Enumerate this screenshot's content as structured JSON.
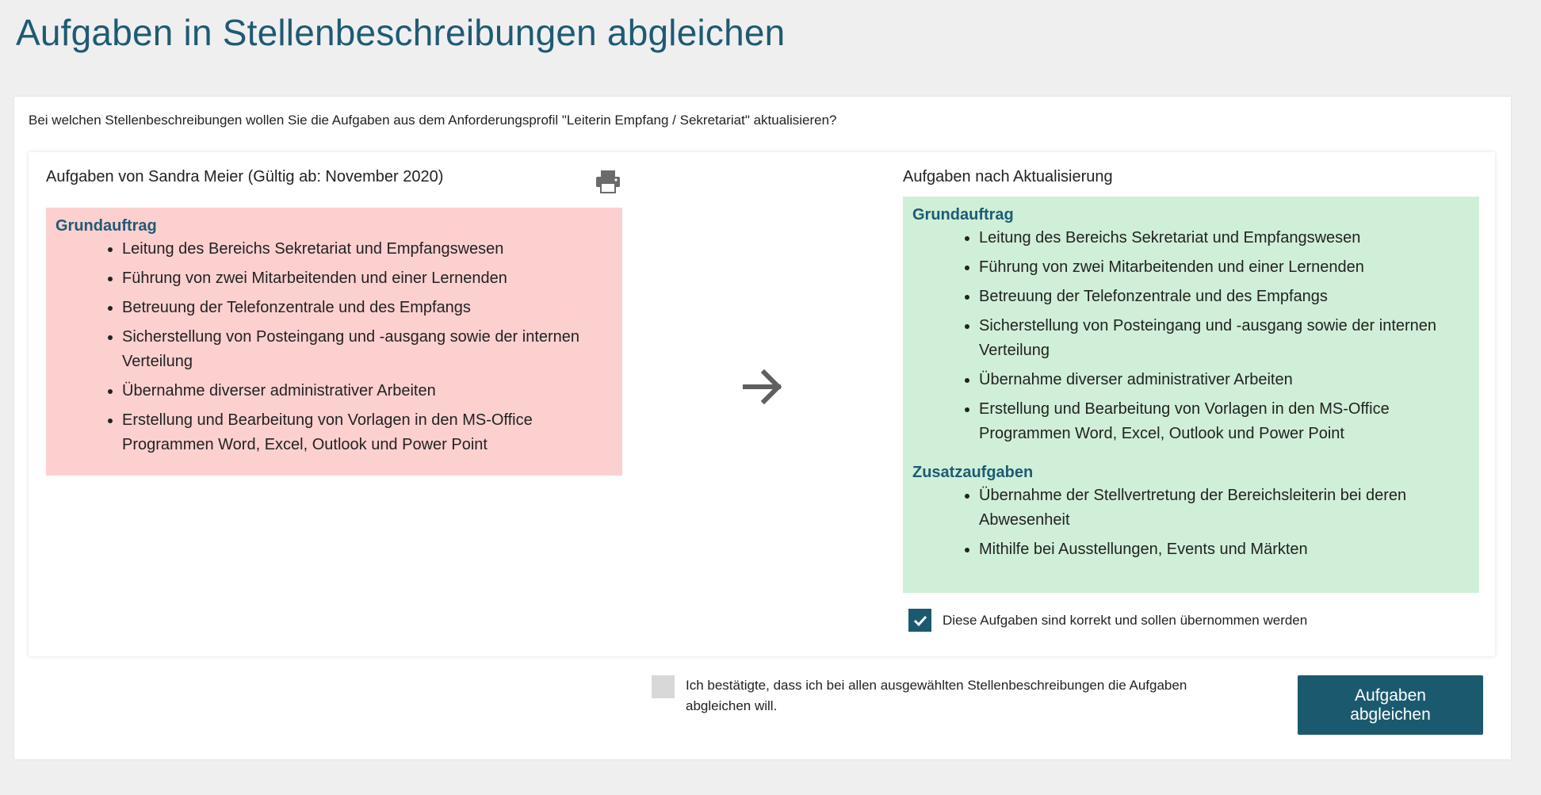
{
  "page": {
    "title": "Aufgaben in Stellenbeschreibungen abgleichen",
    "question": "Bei welchen Stellenbeschreibungen wollen Sie die Aufgaben aus dem Anforderungsprofil \"Leiterin Empfang / Sekretariat\" aktualisieren?"
  },
  "left": {
    "heading": "Aufgaben von Sandra Meier (Gültig ab: November 2020)",
    "print_icon": "print-icon",
    "color": "#fdd0d0",
    "sections": [
      {
        "title": "Grundauftrag",
        "items": [
          "Leitung des Bereichs Sekretariat und Empfangswesen",
          "Führung von zwei Mitarbeitenden und einer Lernenden",
          "Betreuung der Telefonzentrale und des Empfangs",
          "Sicherstellung von Posteingang und -ausgang sowie der internen Verteilung",
          "Übernahme diverser administrativer Arbeiten",
          "Erstellung und Bearbeitung von Vorlagen in den MS-Office Programmen Word, Excel, Outlook und Power Point"
        ]
      }
    ]
  },
  "arrow_icon": "arrow-right-icon",
  "right": {
    "heading": "Aufgaben nach Aktualisierung",
    "color": "#d0efd8",
    "sections": [
      {
        "title": "Grundauftrag",
        "items": [
          "Leitung des Bereichs Sekretariat und Empfangswesen",
          "Führung von zwei Mitarbeitenden und einer Lernenden",
          "Betreuung der Telefonzentrale und des Empfangs",
          "Sicherstellung von Posteingang und -ausgang sowie der internen Verteilung",
          "Übernahme diverser administrativer Arbeiten",
          "Erstellung und Bearbeitung von Vorlagen in den MS-Office Programmen Word, Excel, Outlook und Power Point"
        ]
      },
      {
        "title": "Zusatzaufgaben",
        "items": [
          "Übernahme der Stellvertretung der Bereichsleiterin bei deren Abwesenheit",
          "Mithilfe bei Ausstellungen, Events und Märkten"
        ]
      }
    ],
    "accept_label": "Diese Aufgaben sind korrekt und sollen übernommen werden",
    "accept_checked": true
  },
  "footer": {
    "confirm_label": "Ich bestätigte, dass ich bei allen ausgewählten Stellenbeschreibungen die Aufgaben abgleichen will.",
    "confirm_checked": false,
    "button_label": "Aufgaben abgleichen"
  },
  "colors": {
    "primary": "#1b5a6e",
    "title": "#1e5b73"
  }
}
